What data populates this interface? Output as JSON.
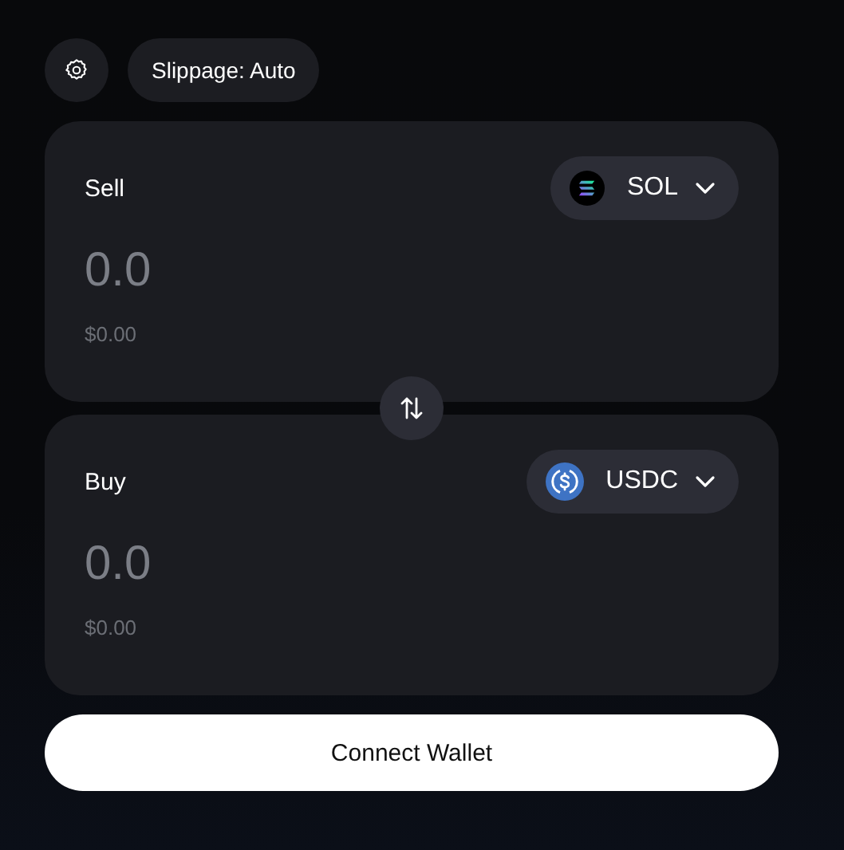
{
  "toolbar": {
    "slippage": "Slippage: Auto"
  },
  "panels": [
    {
      "label": "Sell",
      "token": {
        "symbol": "SOL",
        "kind": "sol"
      },
      "amount_placeholder": "0.0",
      "usd_value": "$0.00"
    },
    {
      "label": "Buy",
      "token": {
        "symbol": "USDC",
        "kind": "usdc"
      },
      "amount_placeholder": "0.0",
      "usd_value": "$0.00"
    }
  ],
  "connect_button": "Connect Wallet"
}
